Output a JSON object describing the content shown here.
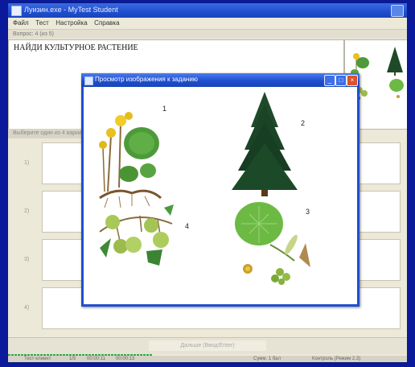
{
  "window": {
    "title": "Луизин.exe - MyTest Student"
  },
  "menu": [
    "Файл",
    "Тест",
    "Настройка",
    "Справка"
  ],
  "question_bar": "Вопрос: 4 (из 5)",
  "task": {
    "text": "НАЙДИ КУЛЬТУРНОЕ РАСТЕНИЕ"
  },
  "answers_header": "Выберите один из 4 вариантов ответа:",
  "answers": [
    {
      "num": "1)"
    },
    {
      "num": "2)"
    },
    {
      "num": "3)"
    },
    {
      "num": "4)"
    }
  ],
  "next_button": "Дальше (Ввод/Enter)",
  "status": {
    "user": "Тест-клиент",
    "count": "1/5",
    "time1": "00:00:11",
    "time2": "00:00:13",
    "score": "Сумм. 1 бал",
    "mode": "Контроль (Режим 2.3)"
  },
  "dialog": {
    "title": "Просмотр изображения к заданию",
    "labels": [
      "1",
      "2",
      "3",
      "4"
    ]
  },
  "colors": {
    "desktop": "#0b1a9a",
    "titlebar": "#1f4fd0",
    "close": "#d9532c",
    "progress": "#2fa84a"
  }
}
